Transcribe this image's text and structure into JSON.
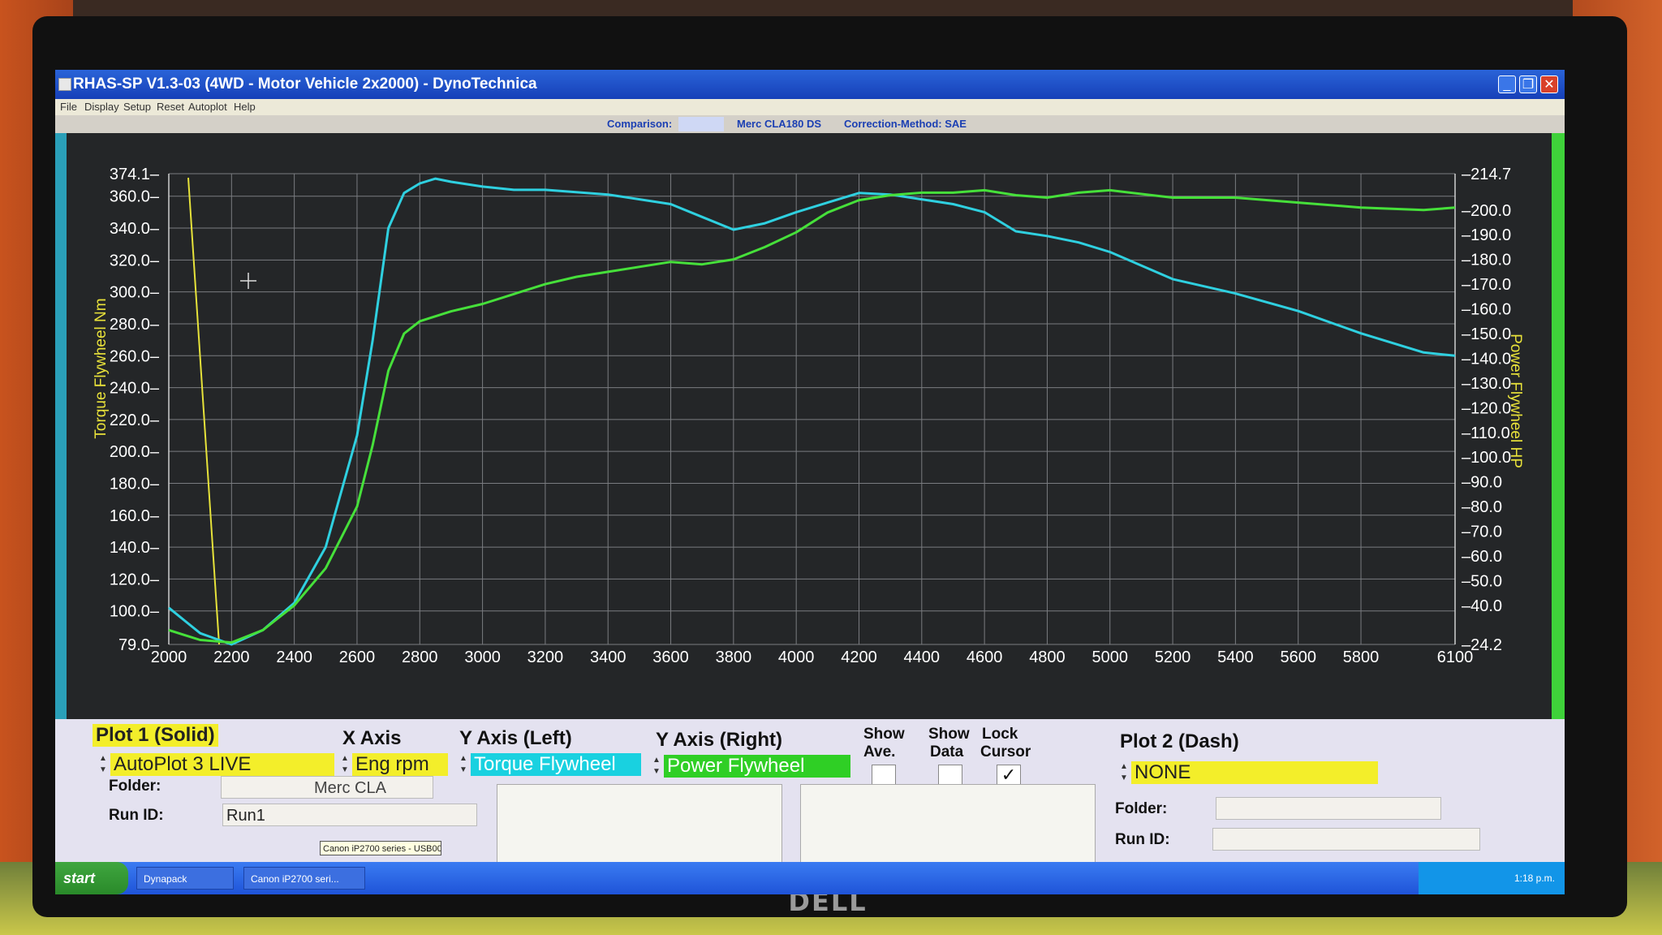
{
  "window": {
    "title": "RHAS-SP V1.3-03  (4WD - Motor Vehicle 2x2000) - DynoTechnica",
    "menus": [
      "File",
      "Display",
      "Setup",
      "Reset",
      "Autoplot",
      "Help"
    ]
  },
  "infobar": {
    "comparison_label": "Comparison:",
    "vehicle": "Merc CLA180 DS",
    "correction": "Correction-Method: SAE"
  },
  "chart_data": {
    "type": "line",
    "xlabel": "",
    "ylabel_left": "Torque Flywheel Nm",
    "ylabel_right": "Power Flywheel HP",
    "xlim": [
      2000,
      6100
    ],
    "ylim_left": [
      79.0,
      374.1
    ],
    "ylim_right": [
      24.2,
      214.7
    ],
    "grid": true,
    "x_ticks": [
      "2000",
      "2200",
      "2400",
      "2600",
      "2800",
      "3000",
      "3200",
      "3400",
      "3600",
      "3800",
      "4000",
      "4200",
      "4400",
      "4600",
      "4800",
      "5000",
      "5200",
      "5400",
      "5600",
      "5800",
      "6100"
    ],
    "left_ticks": [
      "374.1",
      "360.0",
      "340.0",
      "320.0",
      "300.0",
      "280.0",
      "260.0",
      "240.0",
      "220.0",
      "200.0",
      "180.0",
      "160.0",
      "140.0",
      "120.0",
      "100.0",
      "79.0"
    ],
    "right_ticks": [
      "214.7",
      "200.0",
      "190.0",
      "180.0",
      "170.0",
      "160.0",
      "150.0",
      "140.0",
      "130.0",
      "120.0",
      "110.0",
      "100.0",
      "90.0",
      "80.0",
      "70.0",
      "60.0",
      "50.0",
      "40.0",
      "24.2"
    ],
    "series": [
      {
        "name": "Torque Flywheel",
        "axis": "left",
        "color": "#2fd0e0",
        "x": [
          2000,
          2050,
          2100,
          2200,
          2300,
          2400,
          2500,
          2600,
          2650,
          2700,
          2750,
          2800,
          2850,
          2900,
          3000,
          3100,
          3200,
          3400,
          3600,
          3700,
          3800,
          3900,
          4000,
          4100,
          4200,
          4300,
          4400,
          4500,
          4600,
          4700,
          4800,
          4900,
          5000,
          5200,
          5400,
          5600,
          5800,
          6000,
          6100
        ],
        "y": [
          102,
          94,
          86,
          79,
          88,
          105,
          140,
          210,
          270,
          340,
          362,
          368,
          371,
          369,
          366,
          364,
          364,
          361,
          355,
          347,
          339,
          343,
          350,
          356,
          362,
          361,
          358,
          355,
          350,
          338,
          335,
          331,
          325,
          308,
          299,
          288,
          274,
          262,
          260
        ]
      },
      {
        "name": "Power Flywheel",
        "axis": "right",
        "color": "#46e03a",
        "x": [
          2000,
          2050,
          2100,
          2200,
          2300,
          2400,
          2500,
          2600,
          2650,
          2700,
          2750,
          2800,
          2900,
          3000,
          3100,
          3200,
          3300,
          3400,
          3600,
          3700,
          3800,
          3900,
          4000,
          4100,
          4200,
          4300,
          4400,
          4500,
          4600,
          4700,
          4800,
          4900,
          5000,
          5200,
          5400,
          5600,
          5800,
          6000,
          6100
        ],
        "y": [
          30,
          28,
          26,
          25,
          30,
          40,
          55,
          80,
          105,
          135,
          150,
          155,
          159,
          162,
          166,
          170,
          173,
          175,
          179,
          178,
          180,
          185,
          191,
          199,
          204,
          206,
          207,
          207,
          208,
          206,
          205,
          207,
          208,
          205,
          205,
          203,
          201,
          200,
          201
        ]
      }
    ]
  },
  "panel": {
    "plot1_label": "Plot 1 (Solid)",
    "plot1_value": "AutoPlot 3 LIVE",
    "xaxis_label": "X Axis",
    "xaxis_value": "Eng rpm",
    "yleft_label": "Y Axis (Left)",
    "yleft_value": "Torque Flywheel",
    "yright_label": "Y Axis (Right)",
    "yright_value": "Power Flywheel",
    "show_ave_label_1": "Show",
    "show_ave_label_2": "Ave.",
    "show_data_label_1": "Show",
    "show_data_label_2": "Data",
    "lock_cursor_label_1": "Lock",
    "lock_cursor_label_2": "Cursor",
    "show_ave_checked": false,
    "show_data_checked": false,
    "lock_cursor_checked": true,
    "plot2_label": "Plot 2 (Dash)",
    "plot2_value": "NONE",
    "folder_label": "Folder:",
    "folder_value": "Merc CLA",
    "runid_label": "Run ID:",
    "runid_value": "Run1",
    "folder2_label": "Folder:",
    "runid2_label": "Run ID:"
  },
  "taskbar": {
    "start": "start",
    "tasks": [
      "Dynapack",
      "Canon iP2700 seri..."
    ],
    "tooltip": "Canon iP2700 series - USB001",
    "time": "1:18 p.m."
  }
}
